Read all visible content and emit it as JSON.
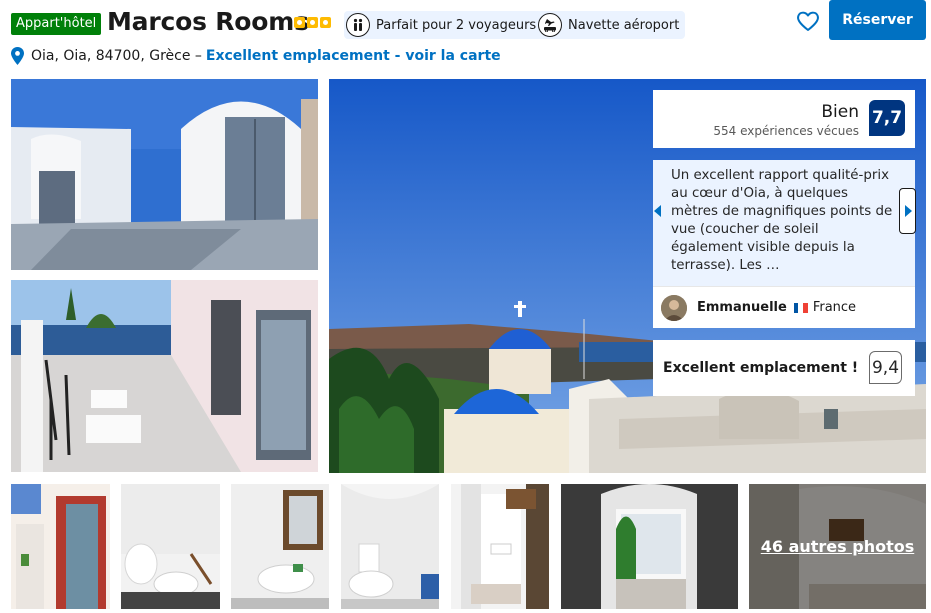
{
  "header": {
    "property_type": "Appart'hôtel",
    "hotel_name": "Marcos Rooms",
    "star_count": 3,
    "amenity_pills": [
      {
        "icon": "two-people-icon",
        "label": "Parfait pour 2 voyageurs"
      },
      {
        "icon": "airport-shuttle-icon",
        "label": "Navette aéroport"
      }
    ],
    "favorite_icon": "heart-icon",
    "reserve_label": "Réserver",
    "address": "Oia, Oia, 84700, Grèce –",
    "map_link": "Excellent emplacement - voir la carte"
  },
  "review_panel": {
    "score_word": "Bien",
    "review_count": "554 expériences vécues",
    "score": "7,7",
    "review_text": "Un excellent rapport qualité-prix au cœur d'Oia, à quelques mètres de magnifiques points de vue (coucher de soleil également visible depuis la terrasse). Les …",
    "author_name": "Emmanuelle",
    "author_country": "France",
    "location_label": "Excellent emplacement !",
    "location_score": "9,4"
  },
  "gallery": {
    "more_photos_label": "46 autres photos"
  },
  "colors": {
    "brand_blue": "#0071c2",
    "score_navy": "#003580",
    "badge_green": "#008009",
    "star_yellow": "#febb02",
    "pill_bg": "#ebf3ff"
  }
}
